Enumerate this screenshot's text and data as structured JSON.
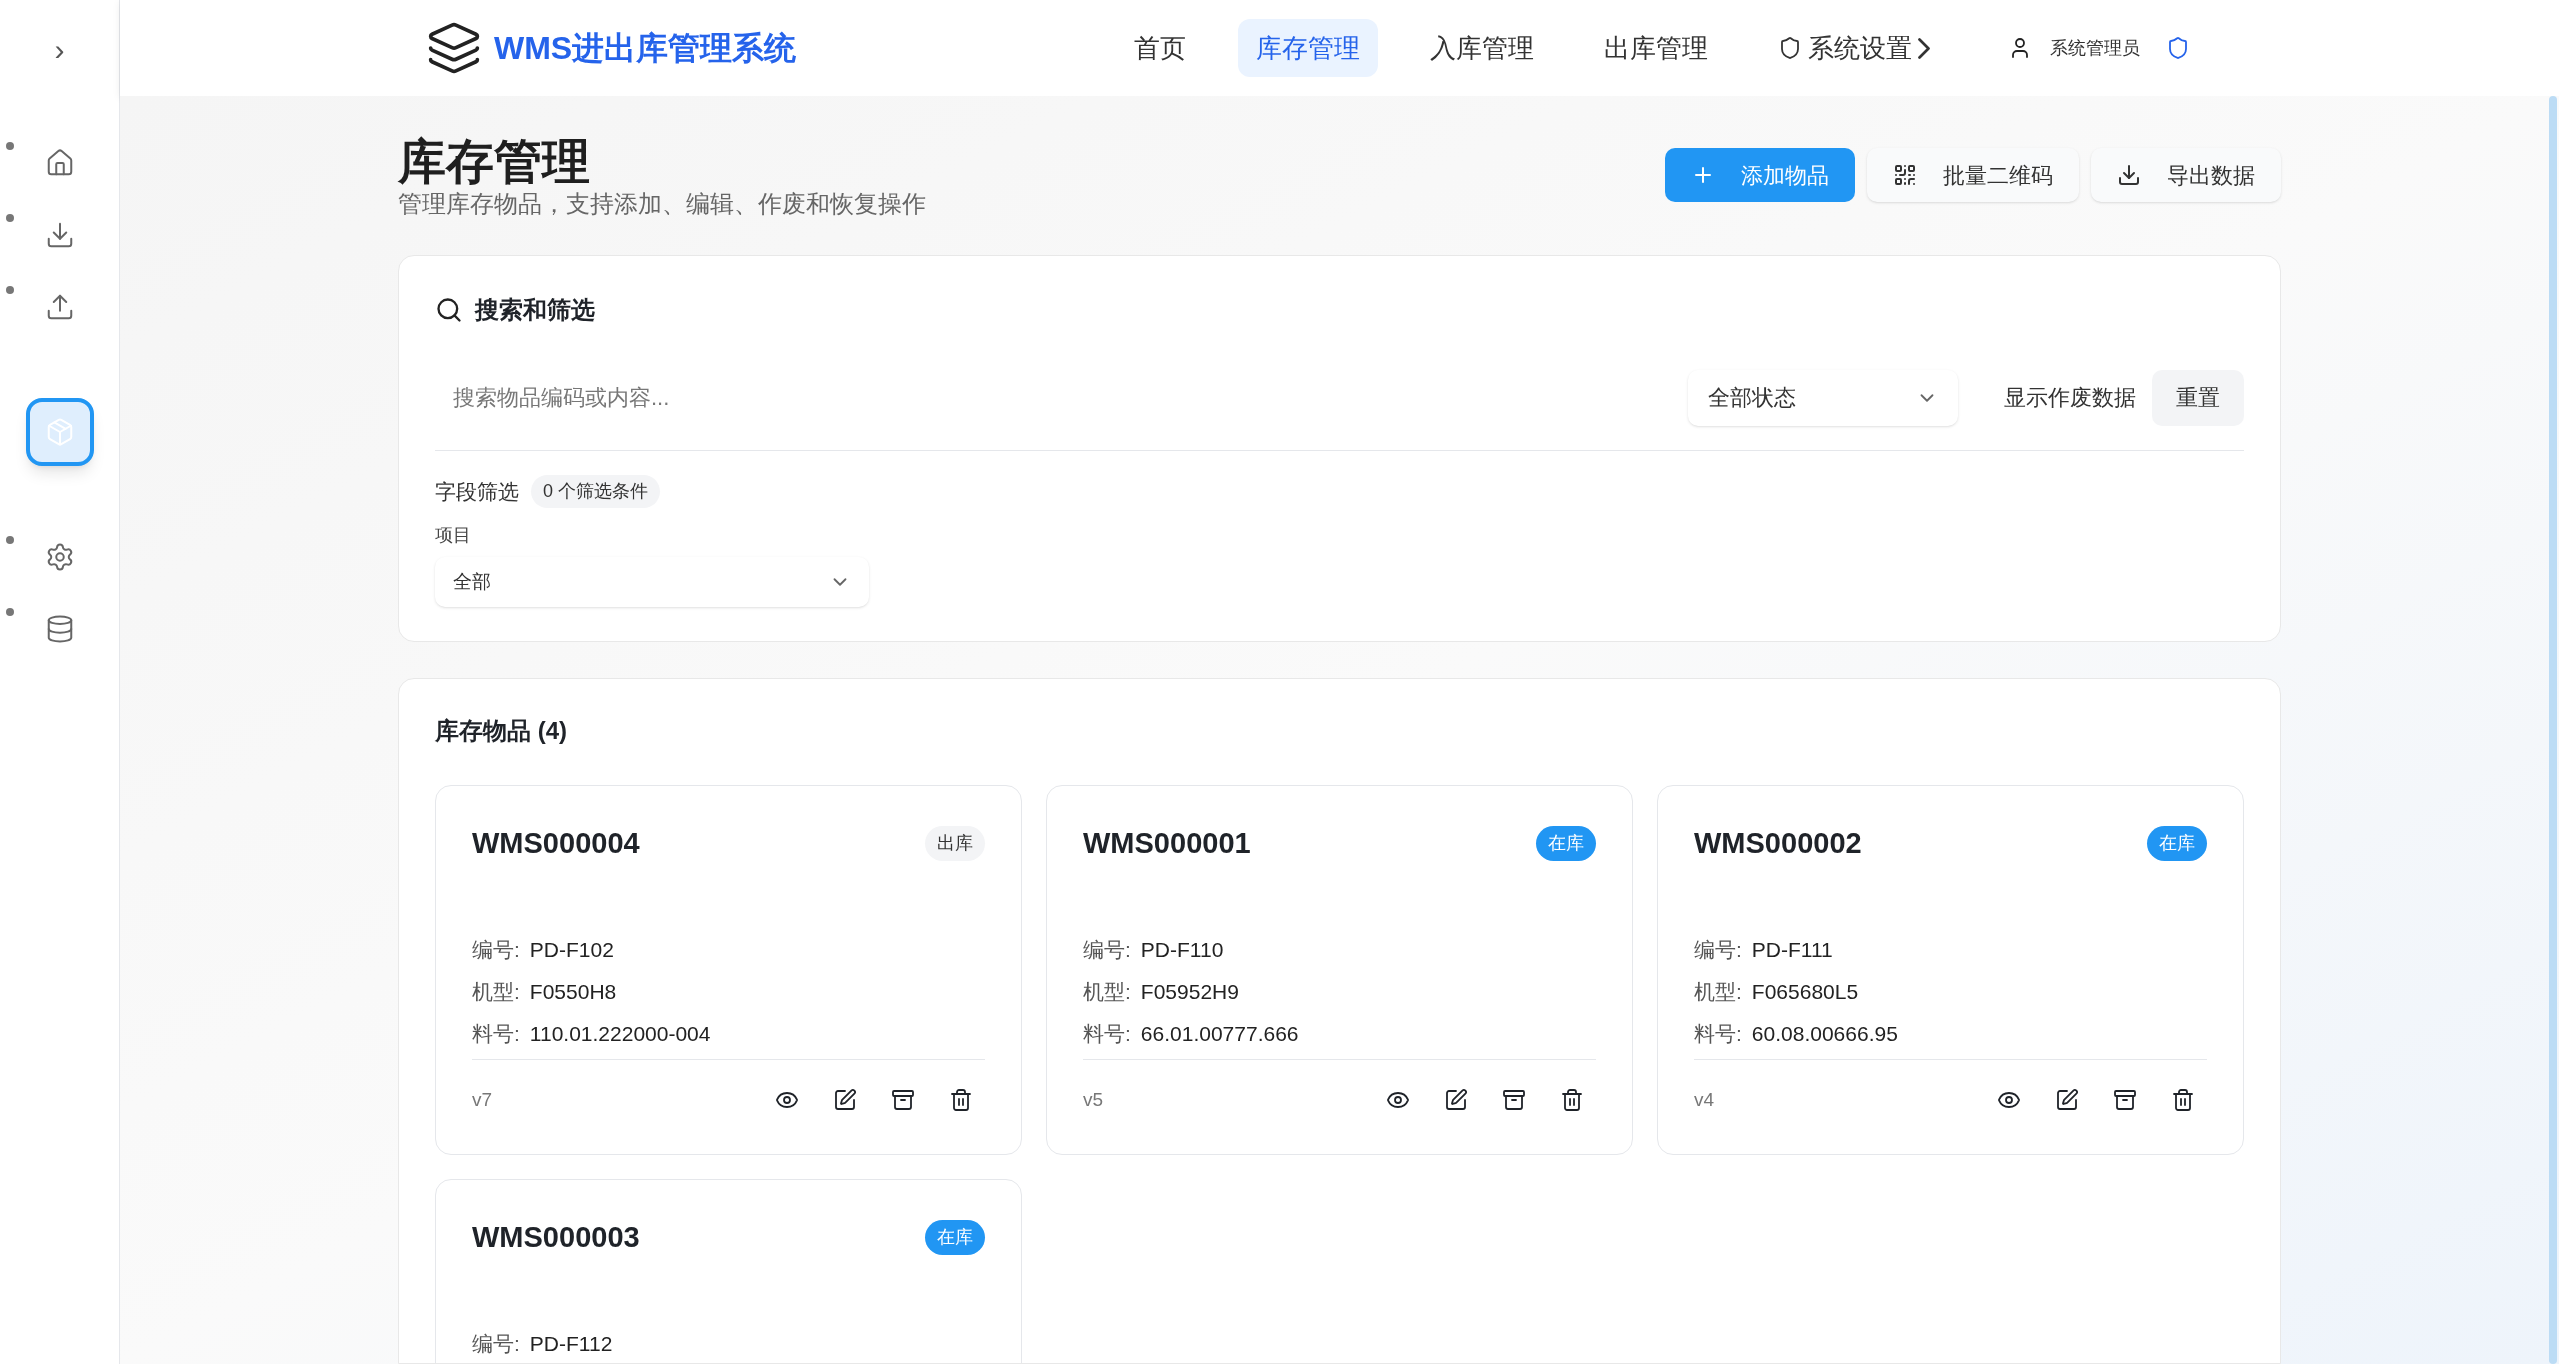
{
  "sidebar": {
    "toggle": "›",
    "items": [
      {
        "kind": "home",
        "selected": false
      },
      {
        "kind": "inbound",
        "selected": false
      },
      {
        "kind": "outbound",
        "selected": false
      },
      {
        "kind": "inventory",
        "selected": true
      },
      {
        "kind": "settings",
        "selected": false
      },
      {
        "kind": "database",
        "selected": false
      }
    ]
  },
  "header": {
    "brand": "WMS进出库管理系统",
    "nav": [
      {
        "label": "首页",
        "selected": false,
        "kind": "plain"
      },
      {
        "label": "库存管理",
        "selected": true,
        "kind": "plain"
      },
      {
        "label": "入库管理",
        "selected": false,
        "kind": "plain"
      },
      {
        "label": "出库管理",
        "selected": false,
        "kind": "plain"
      },
      {
        "label": "系统设置",
        "selected": false,
        "kind": "menu"
      }
    ],
    "user": "系统管理员"
  },
  "page": {
    "title": "库存管理",
    "subtitle": "管理库存物品，支持添加、编辑、作废和恢复操作",
    "actions": [
      {
        "label": "添加物品",
        "kind": "primary"
      },
      {
        "label": "批量二维码",
        "kind": "qr"
      },
      {
        "label": "导出数据",
        "kind": "export"
      }
    ]
  },
  "filters": {
    "title": "搜索和筛选",
    "search_placeholder": "搜索物品编码或内容...",
    "status_select": "全部状态",
    "show_void": "显示作废数据",
    "reset": "重置",
    "field_filter": "字段筛选",
    "filter_count": "0 个筛选条件",
    "project_label": "项目",
    "project_value": "全部"
  },
  "items": {
    "title": "库存物品 (4)",
    "cards": [
      {
        "code": "WMS000004",
        "status": "出库",
        "kind": "out",
        "fields": [
          {
            "label": "编号:",
            "value": "PD-F102"
          },
          {
            "label": "机型:",
            "value": "F0550H8"
          },
          {
            "label": "料号:",
            "value": "110.01.222000-004"
          }
        ],
        "version": "v7"
      },
      {
        "code": "WMS000001",
        "status": "在库",
        "kind": "in",
        "fields": [
          {
            "label": "编号:",
            "value": "PD-F110"
          },
          {
            "label": "机型:",
            "value": "F05952H9"
          },
          {
            "label": "料号:",
            "value": "66.01.00777.666"
          }
        ],
        "version": "v5"
      },
      {
        "code": "WMS000002",
        "status": "在库",
        "kind": "in",
        "fields": [
          {
            "label": "编号:",
            "value": "PD-F111"
          },
          {
            "label": "机型:",
            "value": "F065680L5"
          },
          {
            "label": "料号:",
            "value": "60.08.00666.95"
          }
        ],
        "version": "v4"
      },
      {
        "code": "WMS000003",
        "status": "在库",
        "kind": "in",
        "fields": [
          {
            "label": "编号:",
            "value": "PD-F112"
          }
        ]
      }
    ]
  }
}
